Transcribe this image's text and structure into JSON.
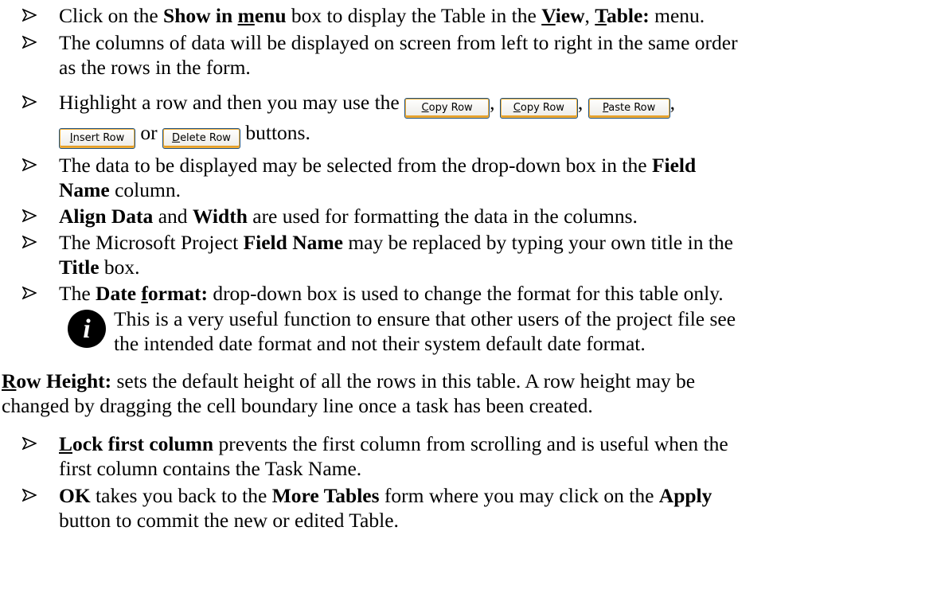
{
  "bullets": {
    "b1": {
      "pre": "Click on the ",
      "b_show": "Show in ",
      "b_menu_u": "m",
      "b_menu_rest": "enu",
      "mid": " box to display the Table in the ",
      "view_u": "V",
      "view_rest": "iew",
      "comma": ", ",
      "table_u": "T",
      "table_rest": "able:",
      "post": " menu."
    },
    "b2": {
      "line1": "The columns of data will be displayed on screen from left to right in the same order",
      "line2": "as the rows in the form."
    },
    "b3": {
      "pre": "Highlight a row and then you may use the ",
      "sep": ",",
      "or": "or",
      "post": "buttons."
    },
    "b4": {
      "line1_pre": "The data to be displayed may be selected from the drop-down box in the ",
      "line1_bold": "Field",
      "line2_bold": "Name",
      "line2_post": " column."
    },
    "b5": {
      "bold1": "Align Data",
      "and": " and ",
      "bold2": "Width",
      "post": " are used for formatting the data in the columns."
    },
    "b6": {
      "line1_pre": "The Microsoft Project ",
      "line1_bold": "Field Name",
      "line1_post": " may be replaced by typing your own title in the",
      "line2_bold": "Title",
      "line2_post": " box."
    },
    "b7": {
      "pre": "The ",
      "bold_a": "Date ",
      "bold_u": "f",
      "bold_b": "ormat:",
      "post": " drop-down box is used to change the format for this table only."
    },
    "b8": {
      "pre": "",
      "bold_u": "L",
      "bold_rest": "ock first column",
      "line1_post": " prevents the first column from scrolling and is useful when the",
      "line2": "first column contains the Task Name."
    },
    "b9": {
      "bold1": "OK",
      "mid1": " takes you back to the ",
      "bold2": "More Tables",
      "mid2": " form where you may click on the ",
      "bold3": "Apply",
      "line2": "button to commit the new or edited Table."
    }
  },
  "buttons": {
    "copy1": {
      "key": "C",
      "rest": "opy Row"
    },
    "copy2": {
      "key": "C",
      "rest": "opy Row"
    },
    "paste": {
      "key": "P",
      "rest": "aste Row"
    },
    "insert": {
      "key": "I",
      "rest": "nsert Row"
    },
    "delete": {
      "key": "D",
      "rest": "elete Row"
    }
  },
  "note": {
    "icon": "info-icon",
    "icon_letter": "i",
    "line1": "This is a very useful function to ensure that other users of the project file see",
    "line2": "the intended date format and not their system default date format."
  },
  "row_height": {
    "bold_u": "R",
    "bold_rest": "ow Height:",
    "line1_post": " sets the default height of all the rows in this table. A row height may be",
    "line2": "changed by dragging the cell boundary line once a task has been created."
  },
  "colors": {
    "button_border": "#1c5180",
    "button_highlight": "#f8b33b",
    "text": "#000000"
  }
}
